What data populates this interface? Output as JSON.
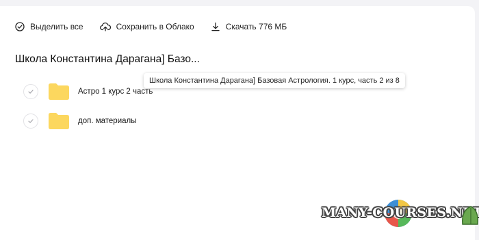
{
  "toolbar": {
    "select_all_label": "Выделить все",
    "save_cloud_label": "Сохранить в Облако",
    "download_label": "Скачать 776 МБ"
  },
  "folder_title": "Школа Константина Дараганa] Базо...",
  "tooltip_text": "Школа Константина Дарагана] Базовая Астрология. 1 курс, часть 2 из 8",
  "items": [
    {
      "label": "Астро 1 курс 2 часть",
      "icon": "folder-icon"
    },
    {
      "label": "доп. материалы",
      "icon": "folder-icon"
    }
  ],
  "watermark_text": "MANY-COURSES.NET",
  "colors": {
    "folder": "#fcd75e",
    "background": "#f3f3f6",
    "panel": "#ffffff"
  }
}
